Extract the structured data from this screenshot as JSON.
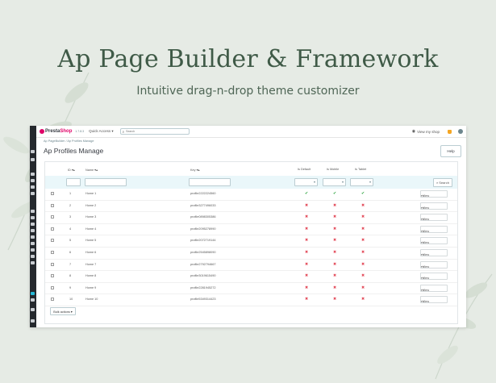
{
  "hero": {
    "title": "Ap Page Builder & Framework",
    "subtitle": "Intuitive drag-n-drop theme customizer"
  },
  "topbar": {
    "logo_presta": "Presta",
    "logo_shop": "Shop",
    "version": "1.7.8.3",
    "quick_access": "Quick Access ▾",
    "search_placeholder": "Search",
    "view_shop": "View my shop"
  },
  "breadcrumb": "Ap PageBuilder  /  Ap Profiles Manage",
  "page_title": "Ap Profiles Manage",
  "help_label": "Help",
  "table": {
    "headers": {
      "id": "ID ▾▴",
      "name": "Name ▾▴",
      "key": "Key ▾▴",
      "default": "Is Default",
      "mobile": "Is Mobile",
      "tablet": "Is Tablet"
    },
    "search_label": "Search",
    "view_label": "View",
    "rows": [
      {
        "id": "1",
        "name": "Home 1",
        "key": "profile2222224560",
        "default": true,
        "mobile": true,
        "tablet": true
      },
      {
        "id": "2",
        "name": "Home 2",
        "key": "profile3277496033",
        "default": false,
        "mobile": false,
        "tablet": false
      },
      {
        "id": "3",
        "name": "Home 3",
        "key": "profile0898305386",
        "default": false,
        "mobile": false,
        "tablet": false
      },
      {
        "id": "4",
        "name": "Home 4",
        "key": "profile2095278990",
        "default": false,
        "mobile": false,
        "tablet": false
      },
      {
        "id": "5",
        "name": "Home 5",
        "key": "profile2072719144",
        "default": false,
        "mobile": false,
        "tablet": false
      },
      {
        "id": "6",
        "name": "Home 6",
        "key": "profile2545898090",
        "default": false,
        "mobile": false,
        "tablet": false
      },
      {
        "id": "7",
        "name": "Home 7",
        "key": "profile2792794667",
        "default": false,
        "mobile": false,
        "tablet": false
      },
      {
        "id": "8",
        "name": "Home 8",
        "key": "profile3019615490",
        "default": false,
        "mobile": false,
        "tablet": false
      },
      {
        "id": "9",
        "name": "Home 9",
        "key": "profile2281945272",
        "default": false,
        "mobile": false,
        "tablet": false
      },
      {
        "id": "10",
        "name": "Home 10",
        "key": "profile5349314423",
        "default": false,
        "mobile": false,
        "tablet": false
      }
    ]
  },
  "bulk_actions": "Bulk actions ▾",
  "icons": {
    "check": "✔",
    "cross": "✖",
    "eye": "◉",
    "search": "⌕",
    "caret": "▾"
  },
  "colors": {
    "background": "#e6ebe5",
    "title": "#3f5a47",
    "brand_pink": "#df0067",
    "sidebar": "#25292e",
    "accent_cyan": "#25b9d7",
    "success": "#2ba23c",
    "danger": "#e34b5a"
  }
}
